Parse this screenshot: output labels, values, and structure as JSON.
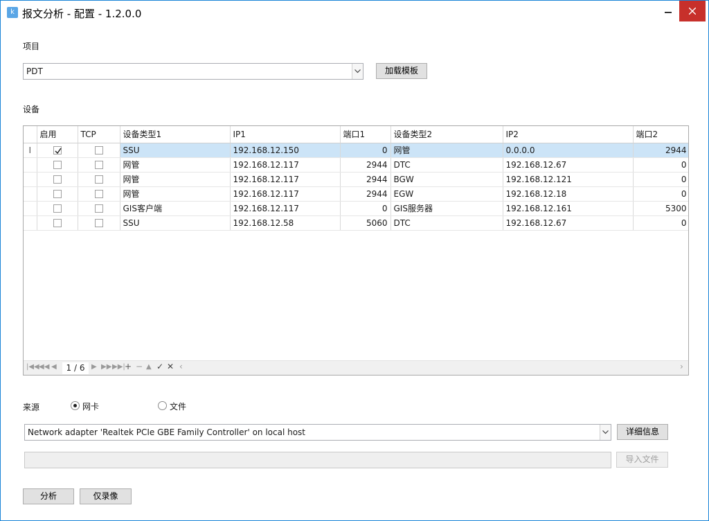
{
  "window": {
    "title": "报文分析 - 配置  -  1.2.0.0",
    "colors": {
      "border": "#1883d7",
      "close": "#c7302b",
      "selected_row": "#cce4f7"
    }
  },
  "project": {
    "label": "项目",
    "selected": "PDT",
    "load_template_label": "加载模板"
  },
  "devices": {
    "label": "设备",
    "columns": [
      "启用",
      "TCP",
      "设备类型1",
      "IP1",
      "端口1",
      "设备类型2",
      "IP2",
      "端口2"
    ],
    "rows": [
      {
        "enabled": true,
        "tcp": false,
        "type1": "SSU",
        "ip1": "192.168.12.150",
        "port1": "0",
        "type2": "网管",
        "ip2": "0.0.0.0",
        "port2": "2944",
        "selected": true
      },
      {
        "enabled": false,
        "tcp": false,
        "type1": "网管",
        "ip1": "192.168.12.117",
        "port1": "2944",
        "type2": "DTC",
        "ip2": "192.168.12.67",
        "port2": "0"
      },
      {
        "enabled": false,
        "tcp": false,
        "type1": "网管",
        "ip1": "192.168.12.117",
        "port1": "2944",
        "type2": "BGW",
        "ip2": "192.168.12.121",
        "port2": "0"
      },
      {
        "enabled": false,
        "tcp": false,
        "type1": "网管",
        "ip1": "192.168.12.117",
        "port1": "2944",
        "type2": "EGW",
        "ip2": "192.168.12.18",
        "port2": "0"
      },
      {
        "enabled": false,
        "tcp": false,
        "type1": "GIS客户端",
        "ip1": "192.168.12.117",
        "port1": "0",
        "type2": "GIS服务器",
        "ip2": "192.168.12.161",
        "port2": "5300"
      },
      {
        "enabled": false,
        "tcp": false,
        "type1": "SSU",
        "ip1": "192.168.12.58",
        "port1": "5060",
        "type2": "DTC",
        "ip2": "192.168.12.67",
        "port2": "0"
      }
    ],
    "pager": {
      "position": "1 / 6"
    }
  },
  "source": {
    "label": "来源",
    "options": [
      {
        "label": "网卡",
        "checked": true
      },
      {
        "label": "文件",
        "checked": false
      }
    ],
    "adapter": "Network adapter 'Realtek PCIe GBE Family Controller' on local host",
    "details_label": "详细信息",
    "file_path": "",
    "import_label": "导入文件"
  },
  "actions": {
    "analyze_label": "分析",
    "record_only_label": "仅录像"
  },
  "icons": {
    "app": "app-logo-icon",
    "row_indicator": "text-cursor-icon"
  }
}
